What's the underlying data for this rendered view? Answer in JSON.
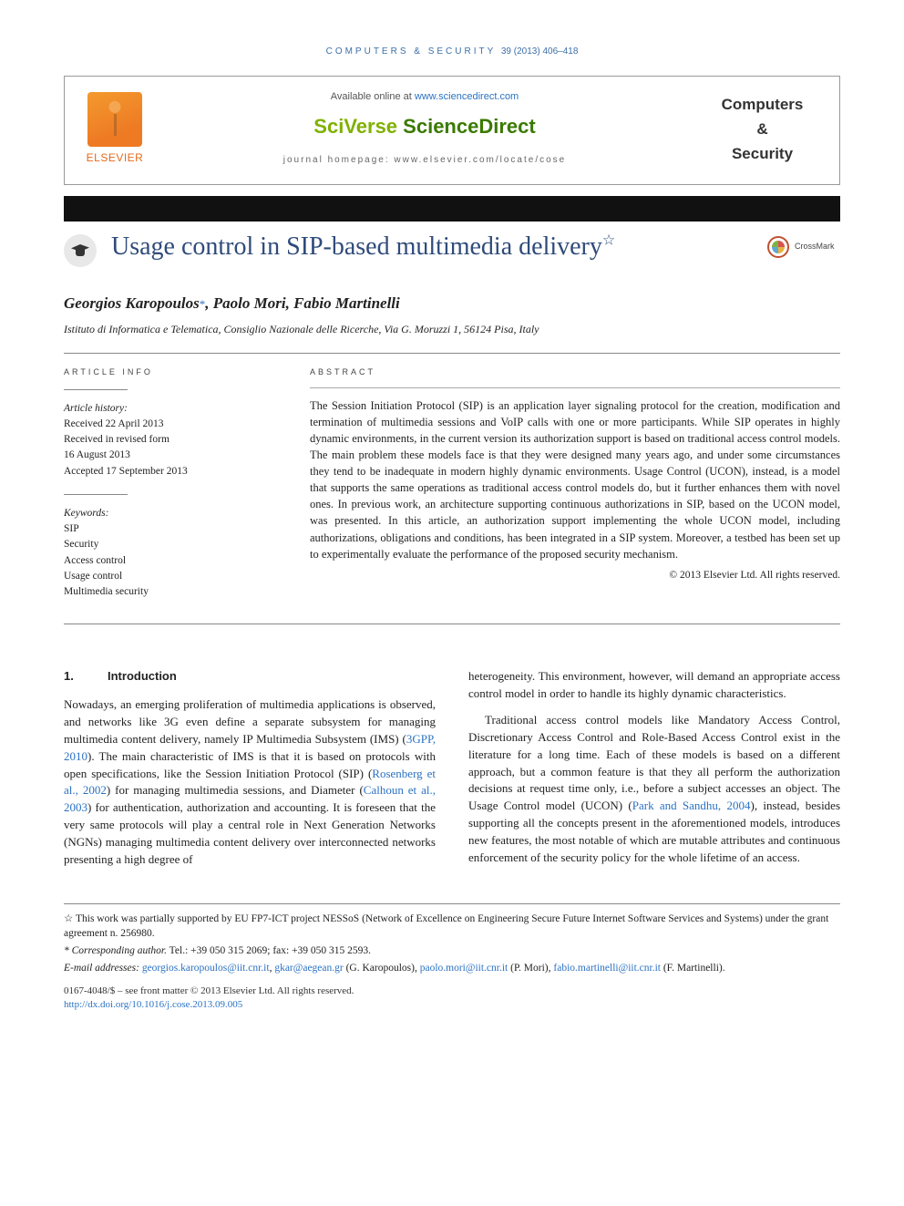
{
  "citation": {
    "journal_caps": "COMPUTERS & SECURITY",
    "vol_pages": "39 (2013) 406–418"
  },
  "header": {
    "available_prefix": "Available online at ",
    "available_url": "www.sciencedirect.com",
    "sciverse_a": "SciVerse ",
    "sciverse_b": "ScienceDirect",
    "homepage_label": "journal homepage: ",
    "homepage_url": "www.elsevier.com/locate/cose",
    "elsevier_name": "ELSEVIER",
    "journal_name_l1": "Computers",
    "journal_name_amp": "&",
    "journal_name_l2": "Security"
  },
  "crossmark_label": "CrossMark",
  "title_main": "Usage control in SIP-based multimedia delivery",
  "title_star": "☆",
  "authors_line": "Georgios Karopoulos",
  "authors_rest": ", Paolo Mori, Fabio Martinelli",
  "author_asterisk": "*",
  "affiliation": "Istituto di Informatica e Telematica, Consiglio Nazionale delle Ricerche, Via G. Moruzzi 1, 56124 Pisa, Italy",
  "labels": {
    "article_info": "ARTICLE INFO",
    "abstract": "ABSTRACT"
  },
  "history": {
    "head": "Article history:",
    "received": "Received 22 April 2013",
    "revised_l1": "Received in revised form",
    "revised_l2": "16 August 2013",
    "accepted": "Accepted 17 September 2013"
  },
  "keywords": {
    "head": "Keywords:",
    "items": [
      "SIP",
      "Security",
      "Access control",
      "Usage control",
      "Multimedia security"
    ]
  },
  "abstract_text": "The Session Initiation Protocol (SIP) is an application layer signaling protocol for the creation, modification and termination of multimedia sessions and VoIP calls with one or more participants. While SIP operates in highly dynamic environments, in the current version its authorization support is based on traditional access control models. The main problem these models face is that they were designed many years ago, and under some circumstances they tend to be inadequate in modern highly dynamic environments. Usage Control (UCON), instead, is a model that supports the same operations as traditional access control models do, but it further enhances them with novel ones. In previous work, an architecture supporting continuous authorizations in SIP, based on the UCON model, was presented. In this article, an authorization support implementing the whole UCON model, including authorizations, obligations and conditions, has been integrated in a SIP system. Moreover, a testbed has been set up to experimentally evaluate the performance of the proposed security mechanism.",
  "copyright": "© 2013 Elsevier Ltd. All rights reserved.",
  "section1": {
    "num": "1.",
    "title": "Introduction",
    "p1a": "Nowadays, an emerging proliferation of multimedia applications is observed, and networks like 3G even define a separate subsystem for managing multimedia content delivery, namely IP Multimedia Subsystem (IMS) (",
    "p1_ref1": "3GPP, 2010",
    "p1b": "). The main characteristic of IMS is that it is based on protocols with open specifications, like the Session Initiation Protocol (SIP) (",
    "p1_ref2": "Rosenberg et al., 2002",
    "p1c": ") for managing multimedia sessions, and Diameter (",
    "p1_ref3": "Calhoun et al., 2003",
    "p1d": ") for authentication, authorization and accounting. It is foreseen that the very same protocols will play a central role in Next Generation Networks (NGNs) managing multimedia content delivery over interconnected networks presenting a high degree of",
    "p1e": "heterogeneity. This environment, however, will demand an appropriate access control model in order to handle its highly dynamic characteristics.",
    "p2a": "Traditional access control models like Mandatory Access Control, Discretionary Access Control and Role-Based Access Control exist in the literature for a long time. Each of these models is based on a different approach, but a common feature is that they all perform the authorization decisions at request time only, i.e., before a subject accesses an object. The Usage Control model (UCON) (",
    "p2_ref1": "Park and Sandhu, 2004",
    "p2b": "), instead, besides supporting all the concepts present in the aforementioned models, introduces new features, the most notable of which are mutable attributes and continuous enforcement of the security policy for the whole lifetime of an access."
  },
  "footnotes": {
    "fn_star": "☆ This work was partially supported by EU FP7-ICT project NESSoS (Network of Excellence on Engineering Secure Future Internet Software Services and Systems) under the grant agreement n. 256980.",
    "fn_corr_label": "* Corresponding author.",
    "fn_corr_rest": " Tel.: +39 050 315 2069; fax: +39 050 315 2593.",
    "email_label": "E-mail addresses: ",
    "emails": [
      {
        "addr": "georgios.karopoulos@iit.cnr.it",
        "who": ""
      },
      {
        "addr": "gkar@aegean.gr",
        "who": " (G. Karopoulos), "
      },
      {
        "addr": "paolo.mori@iit.cnr.it",
        "who": " (P. Mori), "
      },
      {
        "addr": "fabio.martinelli@iit.cnr.it",
        "who": " (F. Martinelli)."
      }
    ],
    "sep_comma": ", "
  },
  "front_matter": {
    "line1": "0167-4048/$ – see front matter © 2013 Elsevier Ltd. All rights reserved.",
    "doi": "http://dx.doi.org/10.1016/j.cose.2013.09.005"
  }
}
